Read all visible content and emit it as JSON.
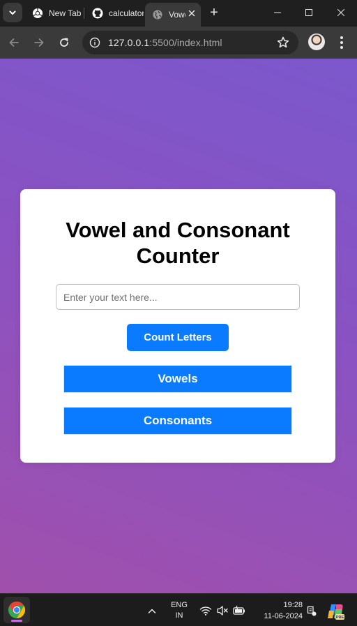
{
  "browser": {
    "tabs": [
      {
        "label": "New Tab",
        "icon": "chrome-icon",
        "active": false
      },
      {
        "label": "calculator",
        "icon": "github-icon",
        "active": false
      },
      {
        "label": "Vowel and Consonant Counter",
        "icon": "globe-icon",
        "active": true
      }
    ],
    "new_tab_label": "+",
    "url_host": "127.0.0.1",
    "url_rest": ":5500/index.html"
  },
  "page": {
    "title": "Vowel and Consonant Counter",
    "input_placeholder": "Enter your text here...",
    "input_value": "",
    "count_button": "Count Letters",
    "vowels_label": "Vowels",
    "consonants_label": "Consonants",
    "accent_color": "#0a7bff"
  },
  "taskbar": {
    "lang_line1": "ENG",
    "lang_line2": "IN",
    "time": "19:28",
    "date": "11-06-2024"
  }
}
